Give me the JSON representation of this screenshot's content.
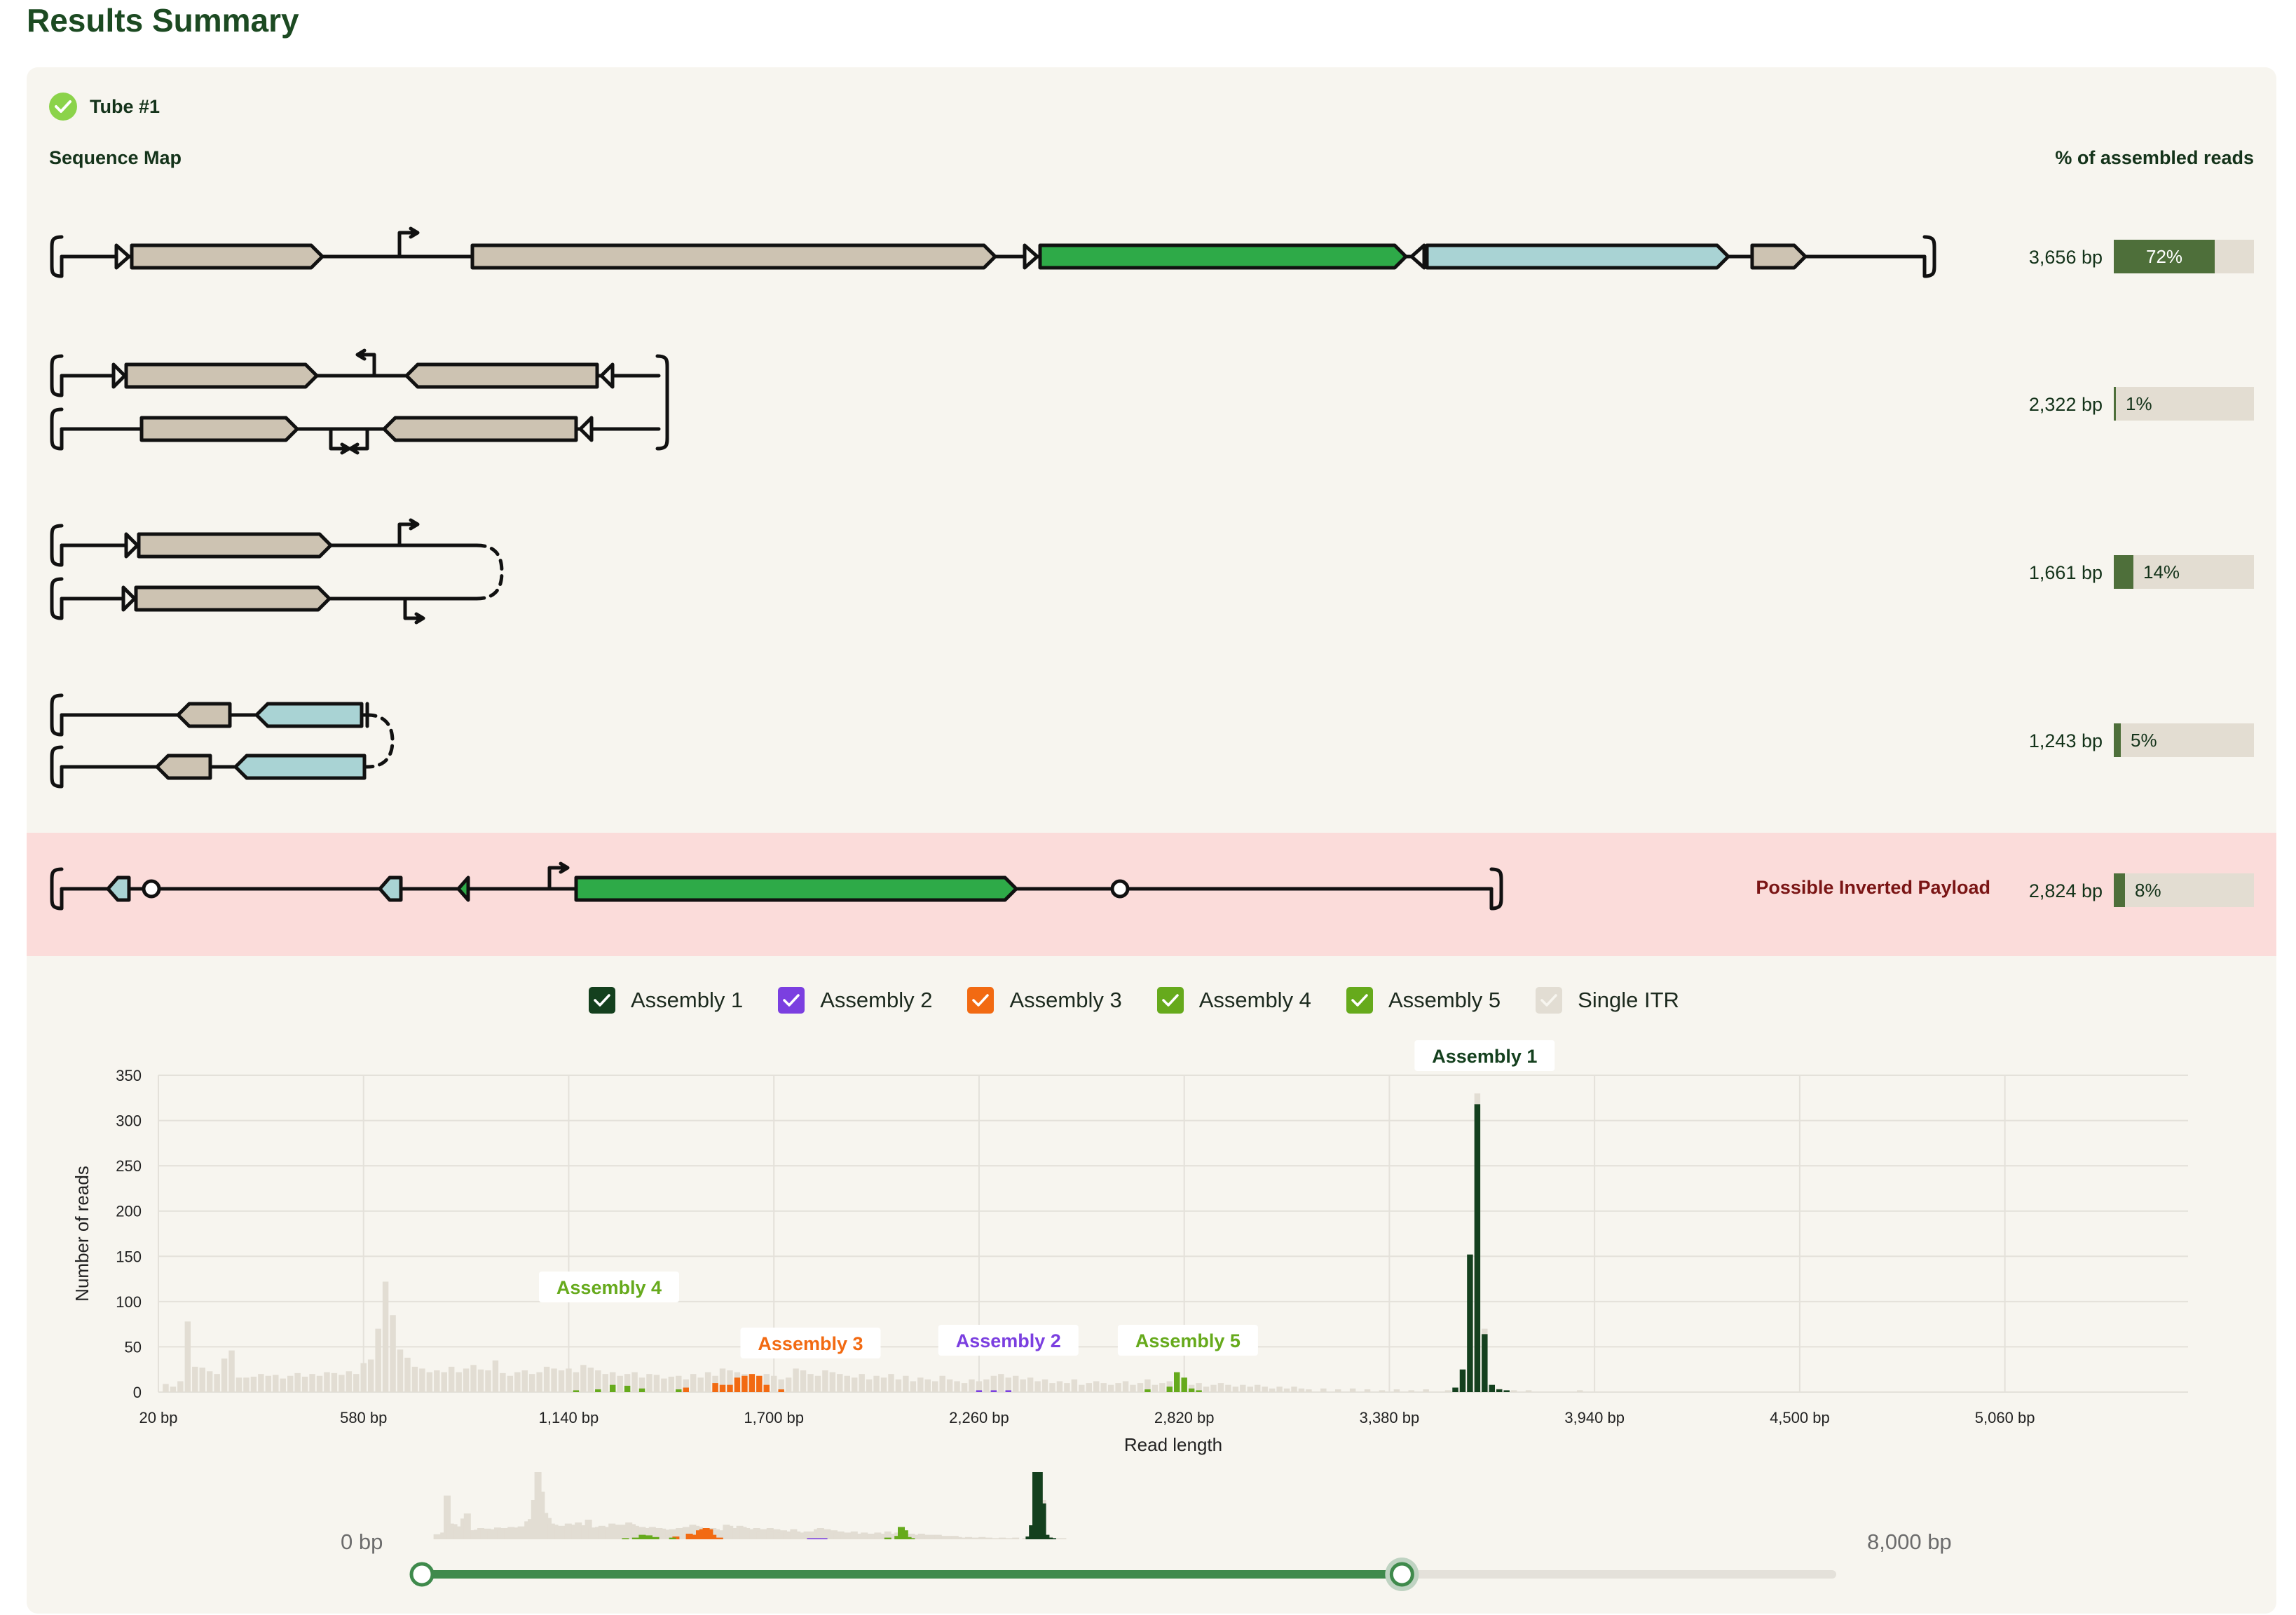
{
  "page_title": "Results Summary",
  "tube": {
    "label": "Tube #1",
    "status": "complete"
  },
  "sequence_map_label": "Sequence Map",
  "percent_header": "% of assembled reads",
  "rows": [
    {
      "length": "3,656 bp",
      "percent": "72%",
      "fraction": 0.72
    },
    {
      "length": "2,322 bp",
      "percent": "1%",
      "fraction": 0.01
    },
    {
      "length": "1,661 bp",
      "percent": "14%",
      "fraction": 0.14
    },
    {
      "length": "1,243 bp",
      "percent": "5%",
      "fraction": 0.05
    },
    {
      "length": "2,824 bp",
      "percent": "8%",
      "fraction": 0.08,
      "flag": "Possible Inverted Payload"
    }
  ],
  "colors": {
    "dark_green": "#14401e",
    "bright_green": "#2eaa48",
    "tan": "#cdc3b2",
    "light_blue": "#a9d3d4",
    "bar_fill": "#4e6f3a",
    "assembly1": "#14401e",
    "assembly2": "#7b3fe0",
    "assembly3": "#f26a12",
    "assembly4": "#66aa1c",
    "assembly5": "#66aa1c",
    "single_itr": "#e2ddd3"
  },
  "legend": [
    {
      "label": "Assembly 1",
      "color": "#14401e",
      "checked": true
    },
    {
      "label": "Assembly 2",
      "color": "#7b3fe0",
      "checked": true
    },
    {
      "label": "Assembly 3",
      "color": "#f26a12",
      "checked": true
    },
    {
      "label": "Assembly 4",
      "color": "#66aa1c",
      "checked": true
    },
    {
      "label": "Assembly 5",
      "color": "#66aa1c",
      "checked": true
    },
    {
      "label": "Single ITR",
      "color": "#e2ddd3",
      "checked": true
    }
  ],
  "chart_data": {
    "type": "bar",
    "xlabel": "Read length",
    "ylabel": "Number of reads",
    "ylim": [
      0,
      350
    ],
    "yticks": [
      "0",
      "50",
      "100",
      "150",
      "200",
      "250",
      "300",
      "350"
    ],
    "xticks": [
      "20 bp",
      "580 bp",
      "1,140 bp",
      "1,700 bp",
      "2,260 bp",
      "2,820 bp",
      "3,380 bp",
      "3,940 bp",
      "4,500 bp",
      "5,060 bp"
    ],
    "xlim": [
      20,
      5560
    ],
    "grid": true,
    "annotations": [
      {
        "label": "Assembly 1",
        "x": 3640,
        "color": "#14401e"
      },
      {
        "label": "Assembly 4",
        "x": 1250,
        "color": "#66aa1c"
      },
      {
        "label": "Assembly 3",
        "x": 1800,
        "color": "#f26a12"
      },
      {
        "label": "Assembly 2",
        "x": 2340,
        "color": "#7b3fe0"
      },
      {
        "label": "Assembly 5",
        "x": 2830,
        "color": "#66aa1c"
      }
    ],
    "series": [
      {
        "name": "Assembly 1",
        "color": "#14401e",
        "points": [
          [
            3560,
            5
          ],
          [
            3580,
            25
          ],
          [
            3600,
            152
          ],
          [
            3620,
            318
          ],
          [
            3640,
            64
          ],
          [
            3660,
            8
          ],
          [
            3680,
            3
          ],
          [
            3700,
            2
          ]
        ]
      },
      {
        "name": "Assembly 2",
        "color": "#7b3fe0",
        "points": [
          [
            2260,
            2
          ],
          [
            2300,
            2
          ],
          [
            2340,
            2
          ]
        ]
      },
      {
        "name": "Assembly 3",
        "color": "#f26a12",
        "points": [
          [
            1460,
            5
          ],
          [
            1540,
            10
          ],
          [
            1560,
            8
          ],
          [
            1580,
            8
          ],
          [
            1600,
            16
          ],
          [
            1620,
            18
          ],
          [
            1640,
            20
          ],
          [
            1660,
            18
          ],
          [
            1680,
            8
          ],
          [
            1720,
            3
          ]
        ]
      },
      {
        "name": "Assembly 4",
        "color": "#66aa1c",
        "points": [
          [
            1160,
            2
          ],
          [
            1220,
            3
          ],
          [
            1260,
            8
          ],
          [
            1300,
            7
          ],
          [
            1340,
            4
          ],
          [
            1440,
            3
          ]
        ]
      },
      {
        "name": "Assembly 5",
        "color": "#66aa1c",
        "points": [
          [
            2720,
            3
          ],
          [
            2780,
            6
          ],
          [
            2800,
            22
          ],
          [
            2820,
            16
          ],
          [
            2840,
            4
          ],
          [
            2860,
            2
          ]
        ]
      }
    ],
    "single_itr_values": [
      [
        40,
        9
      ],
      [
        60,
        6
      ],
      [
        80,
        12
      ],
      [
        100,
        78
      ],
      [
        120,
        28
      ],
      [
        140,
        27
      ],
      [
        160,
        23
      ],
      [
        180,
        20
      ],
      [
        200,
        37
      ],
      [
        220,
        46
      ],
      [
        240,
        16
      ],
      [
        260,
        16
      ],
      [
        280,
        17
      ],
      [
        300,
        20
      ],
      [
        320,
        18
      ],
      [
        340,
        19
      ],
      [
        360,
        15
      ],
      [
        380,
        18
      ],
      [
        400,
        21
      ],
      [
        420,
        17
      ],
      [
        440,
        20
      ],
      [
        460,
        18
      ],
      [
        480,
        22
      ],
      [
        500,
        21
      ],
      [
        520,
        19
      ],
      [
        540,
        23
      ],
      [
        560,
        20
      ],
      [
        580,
        32
      ],
      [
        600,
        36
      ],
      [
        620,
        70
      ],
      [
        640,
        122
      ],
      [
        660,
        85
      ],
      [
        680,
        47
      ],
      [
        700,
        38
      ],
      [
        720,
        28
      ],
      [
        740,
        26
      ],
      [
        760,
        22
      ],
      [
        780,
        24
      ],
      [
        800,
        22
      ],
      [
        820,
        28
      ],
      [
        840,
        22
      ],
      [
        860,
        26
      ],
      [
        880,
        30
      ],
      [
        900,
        25
      ],
      [
        920,
        24
      ],
      [
        940,
        35
      ],
      [
        960,
        21
      ],
      [
        980,
        18
      ],
      [
        1000,
        22
      ],
      [
        1020,
        24
      ],
      [
        1040,
        20
      ],
      [
        1060,
        22
      ],
      [
        1080,
        28
      ],
      [
        1100,
        26
      ],
      [
        1120,
        24
      ],
      [
        1140,
        26
      ],
      [
        1160,
        22
      ],
      [
        1180,
        30
      ],
      [
        1200,
        27
      ],
      [
        1220,
        24
      ],
      [
        1240,
        20
      ],
      [
        1260,
        22
      ],
      [
        1280,
        18
      ],
      [
        1300,
        20
      ],
      [
        1320,
        22
      ],
      [
        1340,
        16
      ],
      [
        1360,
        20
      ],
      [
        1380,
        19
      ],
      [
        1400,
        15
      ],
      [
        1420,
        17
      ],
      [
        1440,
        18
      ],
      [
        1460,
        14
      ],
      [
        1480,
        20
      ],
      [
        1500,
        16
      ],
      [
        1520,
        22
      ],
      [
        1540,
        18
      ],
      [
        1560,
        26
      ],
      [
        1580,
        24
      ],
      [
        1600,
        22
      ],
      [
        1620,
        20
      ],
      [
        1640,
        18
      ],
      [
        1660,
        16
      ],
      [
        1680,
        20
      ],
      [
        1700,
        18
      ],
      [
        1720,
        14
      ],
      [
        1740,
        16
      ],
      [
        1760,
        26
      ],
      [
        1780,
        24
      ],
      [
        1800,
        20
      ],
      [
        1820,
        18
      ],
      [
        1840,
        24
      ],
      [
        1860,
        22
      ],
      [
        1880,
        20
      ],
      [
        1900,
        18
      ],
      [
        1920,
        16
      ],
      [
        1940,
        20
      ],
      [
        1960,
        14
      ],
      [
        1980,
        18
      ],
      [
        2000,
        16
      ],
      [
        2020,
        20
      ],
      [
        2040,
        14
      ],
      [
        2060,
        18
      ],
      [
        2080,
        12
      ],
      [
        2100,
        16
      ],
      [
        2120,
        14
      ],
      [
        2140,
        12
      ],
      [
        2160,
        18
      ],
      [
        2180,
        14
      ],
      [
        2200,
        12
      ],
      [
        2220,
        10
      ],
      [
        2240,
        14
      ],
      [
        2260,
        12
      ],
      [
        2280,
        14
      ],
      [
        2300,
        18
      ],
      [
        2320,
        20
      ],
      [
        2340,
        16
      ],
      [
        2360,
        18
      ],
      [
        2380,
        14
      ],
      [
        2400,
        16
      ],
      [
        2420,
        12
      ],
      [
        2440,
        14
      ],
      [
        2460,
        10
      ],
      [
        2480,
        12
      ],
      [
        2500,
        10
      ],
      [
        2520,
        14
      ],
      [
        2540,
        8
      ],
      [
        2560,
        10
      ],
      [
        2580,
        12
      ],
      [
        2600,
        10
      ],
      [
        2620,
        8
      ],
      [
        2640,
        10
      ],
      [
        2660,
        12
      ],
      [
        2680,
        8
      ],
      [
        2700,
        10
      ],
      [
        2720,
        14
      ],
      [
        2740,
        8
      ],
      [
        2760,
        10
      ],
      [
        2780,
        12
      ],
      [
        2800,
        8
      ],
      [
        2820,
        10
      ],
      [
        2840,
        8
      ],
      [
        2860,
        10
      ],
      [
        2880,
        6
      ],
      [
        2900,
        8
      ],
      [
        2920,
        10
      ],
      [
        2940,
        8
      ],
      [
        2960,
        6
      ],
      [
        2980,
        8
      ],
      [
        3000,
        6
      ],
      [
        3020,
        8
      ],
      [
        3040,
        6
      ],
      [
        3060,
        4
      ],
      [
        3080,
        6
      ],
      [
        3100,
        4
      ],
      [
        3120,
        6
      ],
      [
        3140,
        4
      ],
      [
        3160,
        3
      ],
      [
        3200,
        4
      ],
      [
        3240,
        3
      ],
      [
        3280,
        4
      ],
      [
        3320,
        3
      ],
      [
        3360,
        2
      ],
      [
        3400,
        3
      ],
      [
        3440,
        2
      ],
      [
        3480,
        3
      ],
      [
        3540,
        2
      ],
      [
        3620,
        330
      ],
      [
        3640,
        70
      ],
      [
        3680,
        4
      ],
      [
        3720,
        2
      ],
      [
        3760,
        2
      ],
      [
        3900,
        2
      ]
    ]
  },
  "range_slider": {
    "min_label": "0 bp",
    "max_label": "8,000 bp",
    "low_value": 0,
    "high_value": 5560,
    "max_value": 8000
  }
}
